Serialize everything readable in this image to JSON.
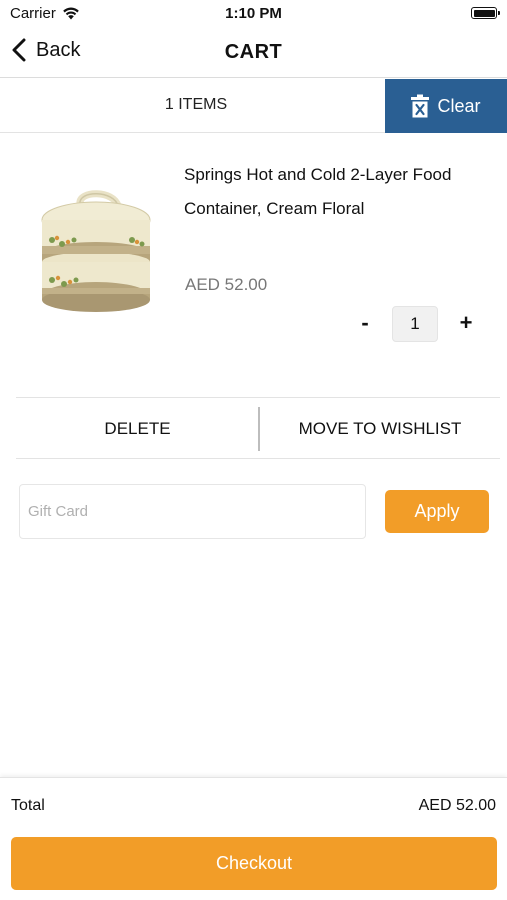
{
  "status_bar": {
    "carrier": "Carrier",
    "time": "1:10 PM",
    "icons": [
      "wifi-icon",
      "battery-icon"
    ]
  },
  "nav": {
    "back_label": "Back",
    "title": "CART"
  },
  "cart_header": {
    "items_count": "1 ITEMS",
    "clear_label": "Clear",
    "clear_icon": "trash-icon"
  },
  "product": {
    "name": "Springs Hot and Cold 2-Layer Food Container, Cream Floral",
    "price": "AED 52.00",
    "quantity": "1",
    "minus_label": "-",
    "plus_label": "+"
  },
  "actions": {
    "delete_label": "DELETE",
    "wishlist_label": "MOVE TO WISHLIST"
  },
  "gift_card": {
    "placeholder": "Gift Card",
    "value": "",
    "apply_label": "Apply"
  },
  "footer": {
    "total_label": "Total",
    "total_value": "AED 52.00",
    "checkout_label": "Checkout"
  },
  "colors": {
    "accent": "#f29d28",
    "clear_button": "#2a5f93",
    "price_text": "#777777"
  }
}
